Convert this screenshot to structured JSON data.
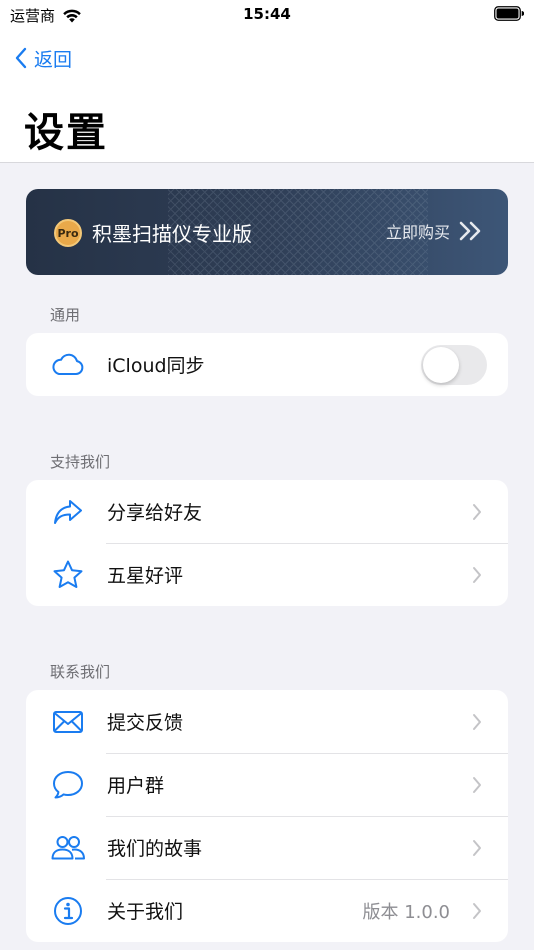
{
  "status_bar": {
    "carrier": "运营商",
    "time": "15:44"
  },
  "nav": {
    "back_label": "返回",
    "title": "设置"
  },
  "pro_banner": {
    "badge": "Pro",
    "title": "积墨扫描仪专业版",
    "buy_label": "立即购买"
  },
  "sections": {
    "general": {
      "header": "通用",
      "icloud_label": "iCloud同步",
      "icloud_enabled": false
    },
    "support": {
      "header": "支持我们",
      "share_label": "分享给好友",
      "rate_label": "五星好评"
    },
    "contact": {
      "header": "联系我们",
      "feedback_label": "提交反馈",
      "group_label": "用户群",
      "story_label": "我们的故事",
      "about_label": "关于我们",
      "version": "版本 1.0.0"
    }
  },
  "colors": {
    "accent": "#1a7cf0",
    "background": "#f2f2f7",
    "banner": "#2f3e56",
    "badge": "#e9a94a"
  },
  "icons": [
    "wifi-icon",
    "battery-icon",
    "back-chevron-icon",
    "double-chevron-icon",
    "cloud-icon",
    "share-arrow-icon",
    "star-icon",
    "mail-icon",
    "chat-bubble-icon",
    "people-icon",
    "info-icon",
    "chevron-right-icon"
  ]
}
